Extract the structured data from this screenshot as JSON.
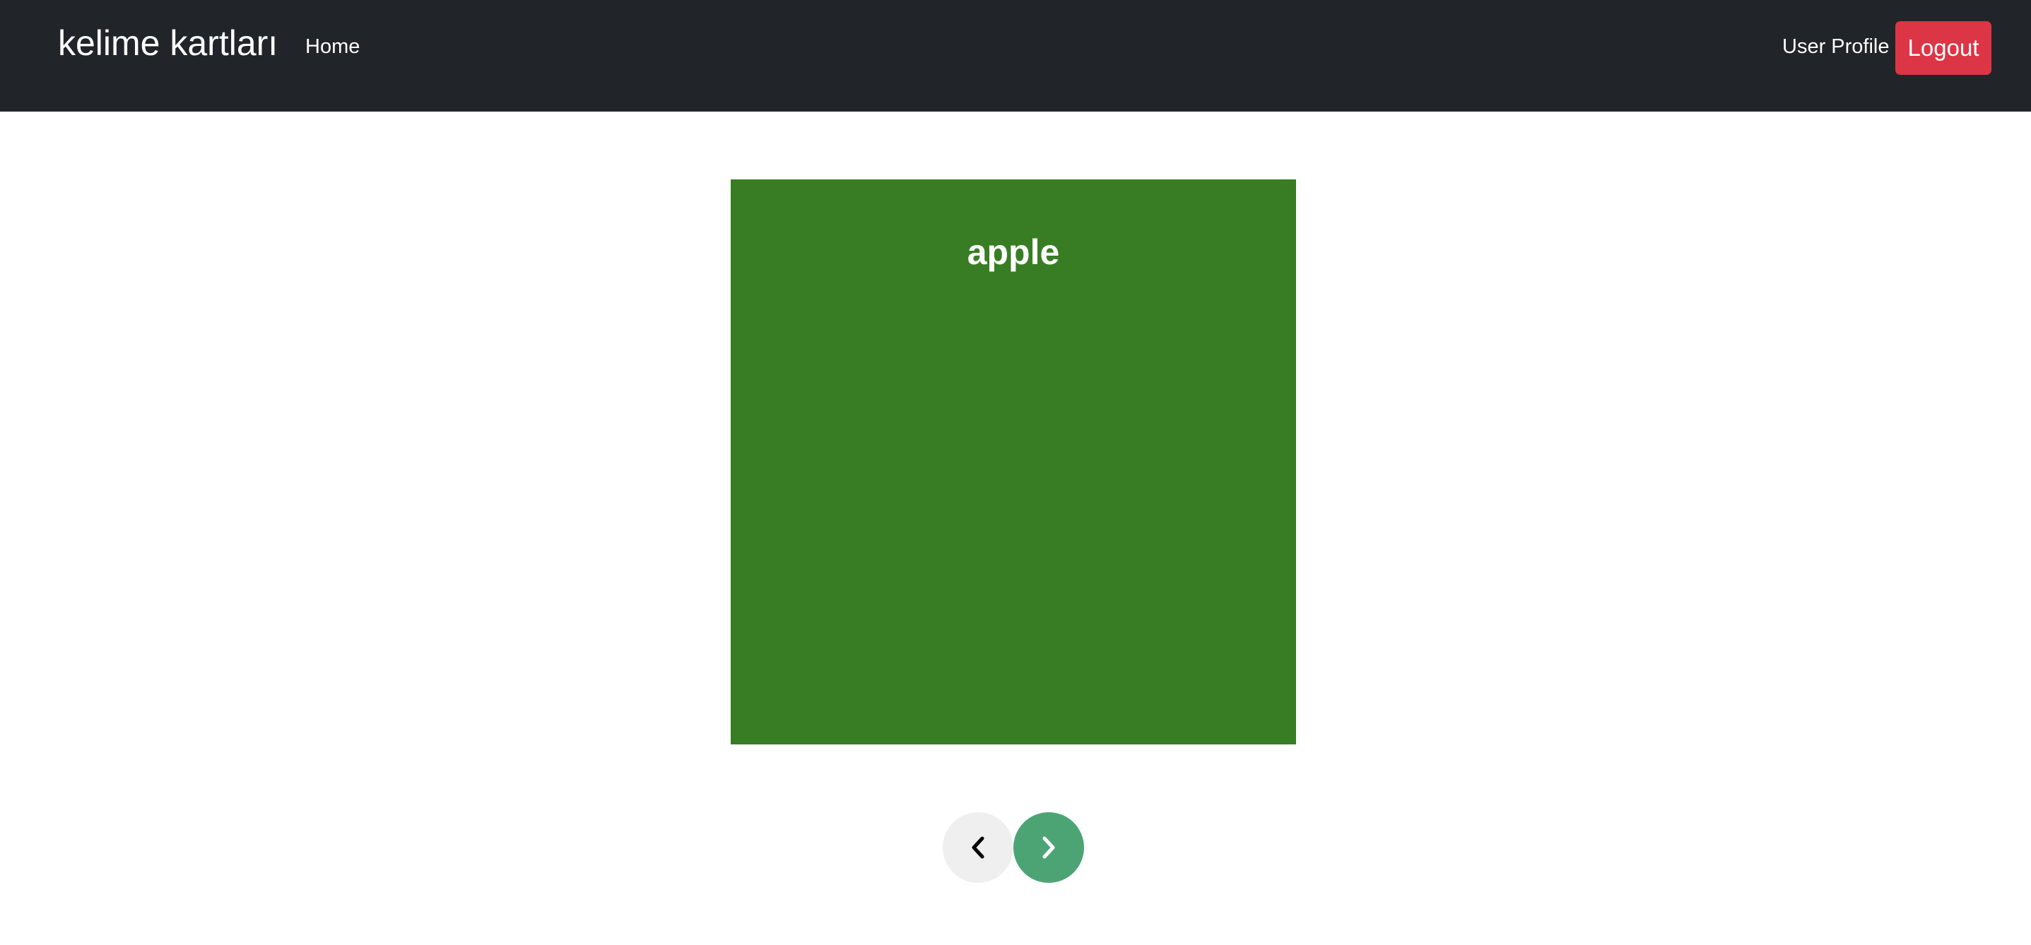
{
  "navbar": {
    "brand": "kelime kartları",
    "home_label": "Home",
    "profile_label": "User Profile",
    "logout_label": "Logout"
  },
  "card": {
    "word": "apple",
    "background_color": "#387d24"
  },
  "controls": {
    "prev_icon": "chevron-left-icon",
    "next_icon": "chevron-right-icon",
    "prev_color": "#efefef",
    "next_color": "#4ca474"
  },
  "colors": {
    "navbar": "#212529",
    "logout": "#dc3545"
  }
}
